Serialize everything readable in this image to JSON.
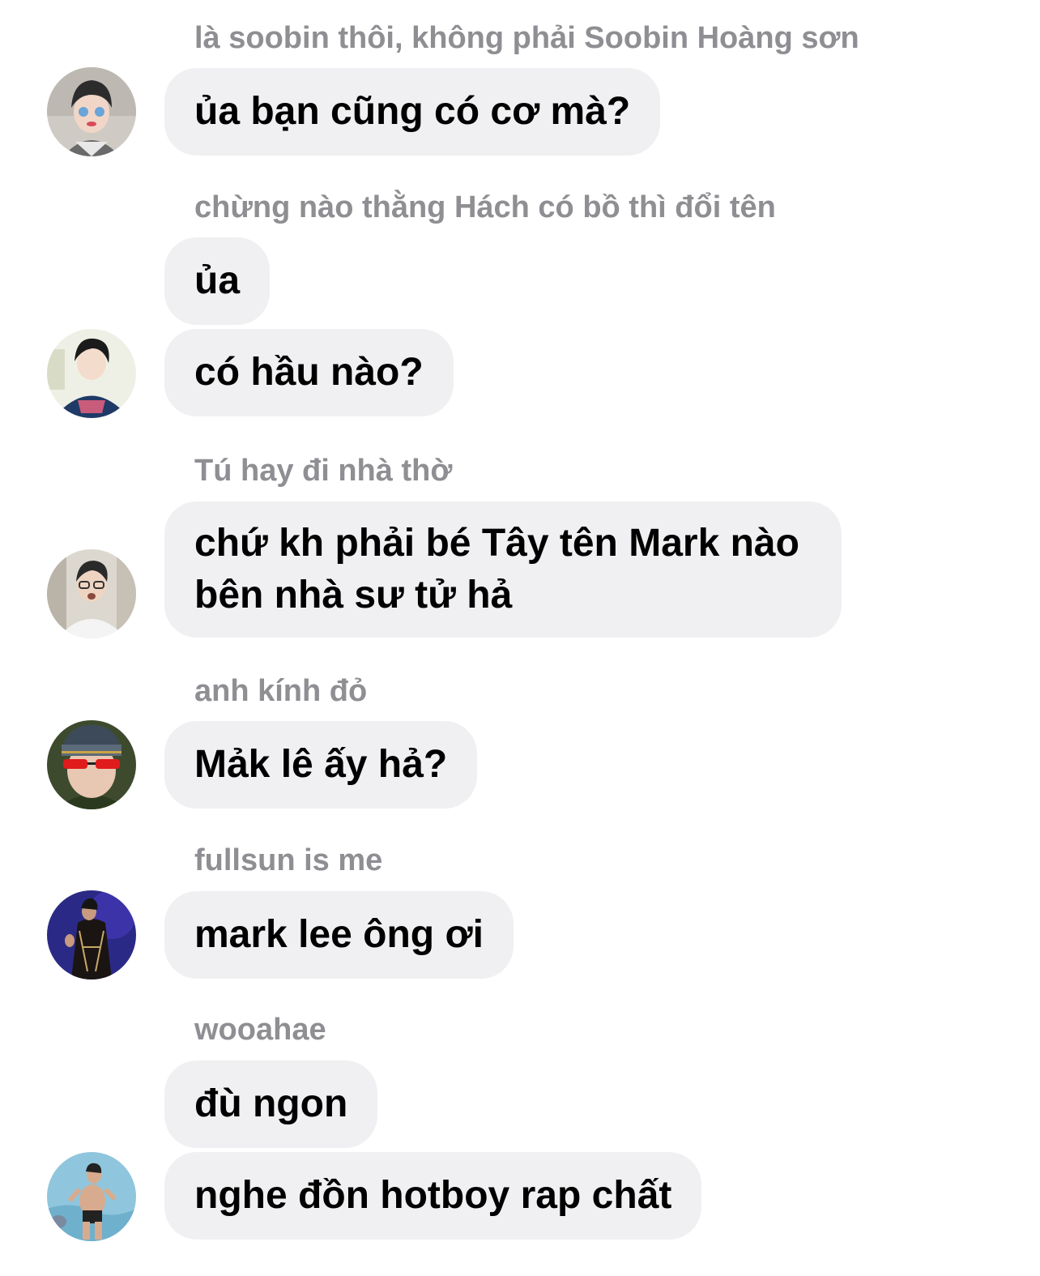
{
  "messages": [
    {
      "sender": "là soobin thôi, không phải Soobin Hoàng sơn",
      "bubbles": [
        "ủa bạn cũng có cơ mà?"
      ],
      "avatar": "avatar-1-icon"
    },
    {
      "sender": "chừng nào thằng Hách có bồ thì đổi tên",
      "bubbles": [
        "ủa",
        "có hầu nào?"
      ],
      "avatar": "avatar-2-icon"
    },
    {
      "sender": "Tú hay đi nhà thờ",
      "bubbles": [
        [
          "chứ kh phải bé Tây tên Mark nào",
          "bên nhà sư tử hả"
        ]
      ],
      "avatar": "avatar-3-icon"
    },
    {
      "sender": "anh kính đỏ",
      "bubbles": [
        "Mảk lê ấy hả?"
      ],
      "avatar": "avatar-4-icon"
    },
    {
      "sender": "fullsun is me",
      "bubbles": [
        "mark lee ông ơi"
      ],
      "avatar": "avatar-5-icon"
    },
    {
      "sender": "wooahae",
      "bubbles": [
        "đù ngon",
        "nghe đồn hotboy rap chất"
      ],
      "avatar": "avatar-6-icon"
    }
  ],
  "colors": {
    "bubble_bg": "#f0f0f2",
    "sender_text": "#8e8e93",
    "message_text": "#000000"
  }
}
